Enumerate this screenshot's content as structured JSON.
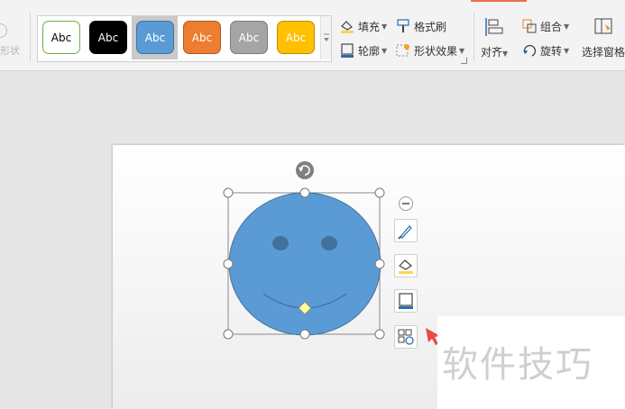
{
  "ribbon": {
    "left_fragment_label": "形状",
    "style_gallery": {
      "swatches": [
        {
          "label": "Abc",
          "bg": "#ffffff",
          "border": "#70ad47",
          "text": "#000000"
        },
        {
          "label": "Abc",
          "bg": "#000000",
          "border": "#000000",
          "text": "#ffffff"
        },
        {
          "label": "Abc",
          "bg": "#5b9bd5",
          "border": "#41719c",
          "text": "#ffffff"
        },
        {
          "label": "Abc",
          "bg": "#ed7d31",
          "border": "#ae5a21",
          "text": "#ffffff"
        },
        {
          "label": "Abc",
          "bg": "#a5a5a5",
          "border": "#7c7c7c",
          "text": "#ffffff"
        },
        {
          "label": "Abc",
          "bg": "#ffc000",
          "border": "#bc8c00",
          "text": "#ffffff"
        }
      ],
      "selected_index": 2
    },
    "fill_label": "填充",
    "format_painter_label": "格式刷",
    "outline_label": "轮廓",
    "shape_effects_label": "形状效果",
    "align_label": "对齐",
    "group_label": "组合",
    "rotate_label": "旋转",
    "selection_pane_label": "选择窗格"
  },
  "canvas": {
    "shape": "smiley-face",
    "fill": "#5b9bd5",
    "eye_color": "#41719c",
    "mouth_color": "#41719c",
    "handle_diamond_color": "#ffff99"
  },
  "watermark": "软件技巧",
  "colors": {
    "ribbon_bg": "#f3f3f3",
    "workspace_bg": "#e6e6e6",
    "slide_bg": "#ffffff",
    "accent": "#ee6e4b",
    "pointer_arrow": "#e84a4a"
  }
}
